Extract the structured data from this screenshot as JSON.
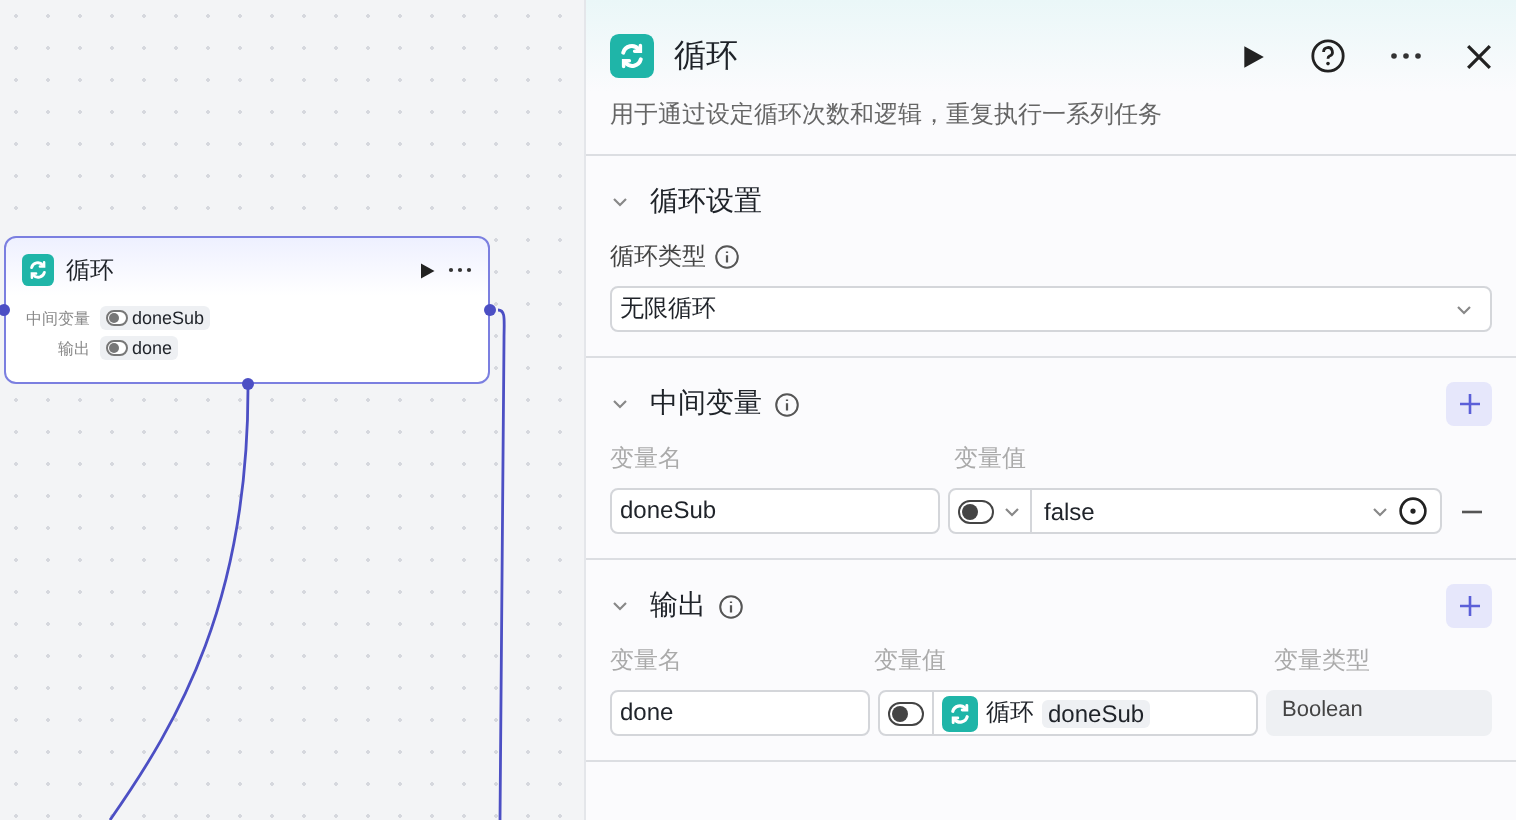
{
  "canvas": {
    "node": {
      "title": "循环",
      "rows": [
        {
          "label": "中间变量",
          "value": "doneSub"
        },
        {
          "label": "输出",
          "value": "done"
        }
      ]
    }
  },
  "panel": {
    "title": "循环",
    "description": "用于通过设定循环次数和逻辑，重复执行一系列任务",
    "sections": [
      {
        "kind": "select",
        "title": "循环设置",
        "expanded": true,
        "field_label": "循环类型",
        "value": "无限循环"
      },
      {
        "kind": "variables",
        "title": "中间变量",
        "expanded": true,
        "columns": [
          "变量名",
          "变量值"
        ],
        "rows": [
          {
            "name": "doneSub",
            "value": "false"
          }
        ]
      },
      {
        "kind": "outputs",
        "title": "输出",
        "expanded": true,
        "columns": [
          "变量名",
          "变量值",
          "变量类型"
        ],
        "rows": [
          {
            "name": "done",
            "source_node": "循环",
            "value": "doneSub",
            "type": "Boolean"
          }
        ]
      }
    ]
  }
}
